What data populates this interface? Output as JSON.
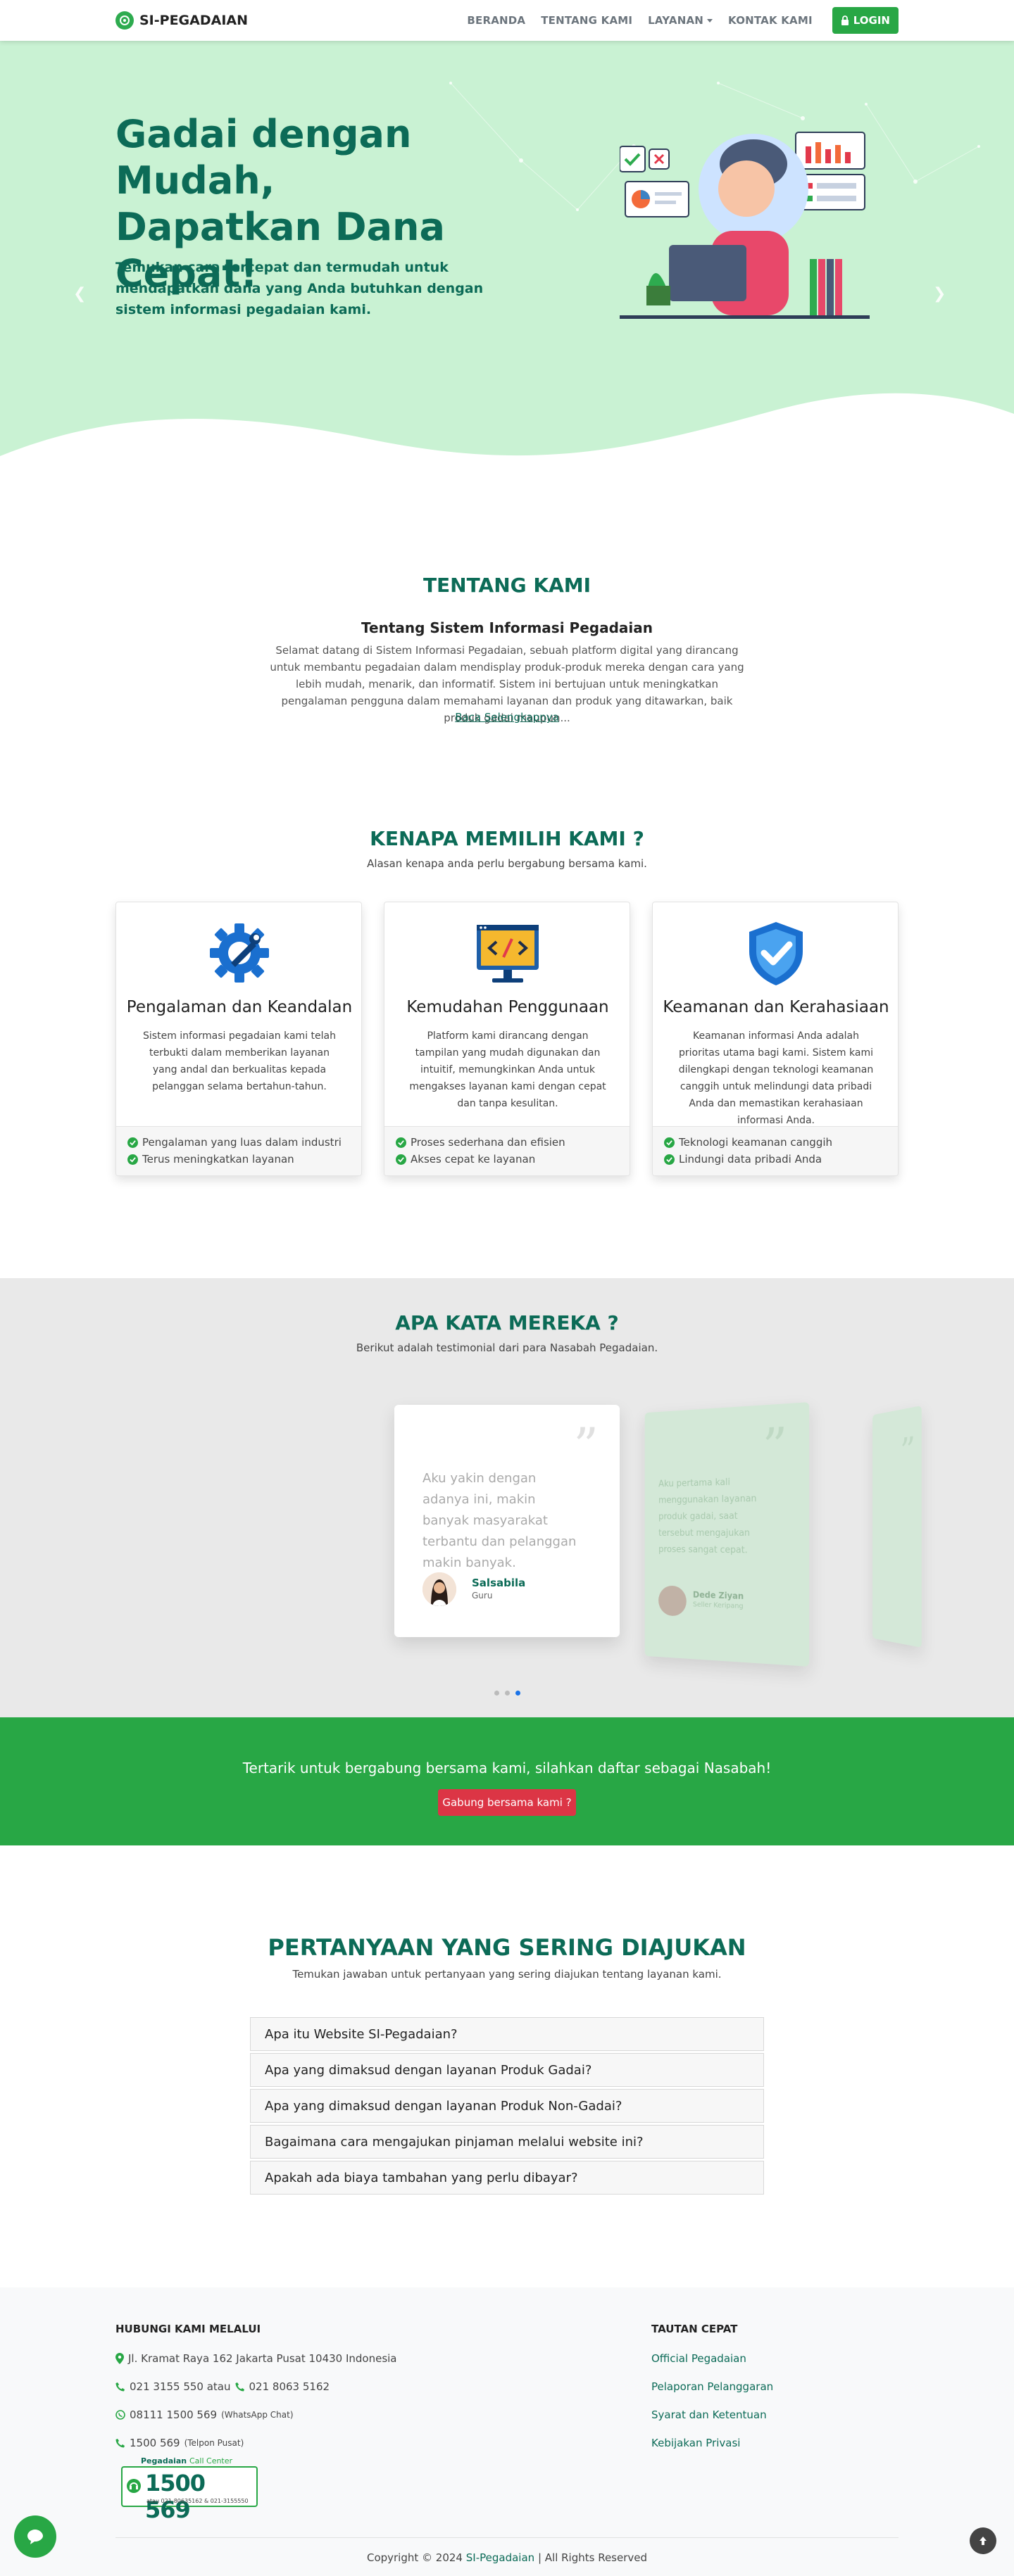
{
  "navbar": {
    "brand": "SI-PEGADAIAN",
    "links": [
      "BERANDA",
      "TENTANG KAMI",
      "LAYANAN",
      "KONTAK KAMI"
    ],
    "login": "LOGIN"
  },
  "hero": {
    "title": "Gadai dengan Mudah, Dapatkan Dana Cepat!",
    "subtitle": "Temukan cara tercepat dan termudah untuk mendapatkan dana yang Anda butuhkan dengan sistem informasi pegadaian kami."
  },
  "tentang": {
    "title": "TENTANG KAMI",
    "subtitle": "Tentang Sistem Informasi Pegadaian",
    "body": "Selamat datang di Sistem Informasi Pegadaian, sebuah platform digital yang dirancang untuk membantu pegadaian dalam mendisplay produk-produk mereka dengan cara yang lebih mudah, menarik, dan informatif. Sistem ini bertujuan untuk meningkatkan pengalaman pengguna dalam memahami layanan dan produk yang ditawarkan, baik produk gadai maupun...",
    "read_more": "Baca Selengkapnya"
  },
  "why": {
    "title": "KENAPA MEMILIH KAMI ?",
    "subtitle": "Alasan kenapa anda perlu bergabung bersama kami.",
    "cards": [
      {
        "icon": "gear-wrench-icon",
        "title": "Pengalaman dan Keandalan",
        "desc": "Sistem informasi pegadaian kami telah terbukti dalam memberikan layanan yang andal dan berkualitas kepada pelanggan selama bertahun-tahun.",
        "points": [
          "Pengalaman yang luas dalam industri",
          "Terus meningkatkan layanan"
        ]
      },
      {
        "icon": "monitor-code-icon",
        "title": "Kemudahan Penggunaan",
        "desc": "Platform kami dirancang dengan tampilan yang mudah digunakan dan intuitif, memungkinkan Anda untuk mengakses layanan kami dengan cepat dan tanpa kesulitan.",
        "points": [
          "Proses sederhana dan efisien",
          "Akses cepat ke layanan"
        ]
      },
      {
        "icon": "shield-check-icon",
        "title": "Keamanan dan Kerahasiaan",
        "desc": "Keamanan informasi Anda adalah prioritas utama bagi kami. Sistem kami dilengkapi dengan teknologi keamanan canggih untuk melindungi data pribadi Anda dan memastikan kerahasiaan informasi Anda.",
        "points": [
          "Teknologi keamanan canggih",
          "Lindungi data pribadi Anda"
        ]
      }
    ]
  },
  "testimonials": {
    "title": "APA KATA MEREKA ?",
    "subtitle": "Berikut adalah testimonial dari para Nasabah Pegadaian.",
    "main": {
      "quote": "Aku yakin dengan adanya ini, makin banyak masyarakat terbantu dan pelanggan makin banyak.",
      "name": "Salsabila",
      "role": "Guru"
    },
    "side": {
      "quote": "Aku pertama kali menggunakan layanan produk gadai, saat tersebut mengajukan proses sangat cepat.",
      "name": "Dede Ziyan",
      "role": "Seller Keripang"
    },
    "active_slide": 3,
    "slides": 3
  },
  "cta": {
    "text": "Tertarik untuk bergabung bersama kami, silahkan daftar sebagai Nasabah!",
    "button": "Gabung bersama kami ?"
  },
  "faq": {
    "title": "PERTANYAAN YANG SERING DIAJUKAN",
    "subtitle": "Temukan jawaban untuk pertanyaan yang sering diajukan tentang layanan kami.",
    "items": [
      "Apa itu Website SI-Pegadaian?",
      "Apa yang dimaksud dengan layanan Produk Gadai?",
      "Apa yang dimaksud dengan layanan Produk Non-Gadai?",
      "Bagaimana cara mengajukan pinjaman melalui website ini?",
      "Apakah ada biaya tambahan yang perlu dibayar?"
    ]
  },
  "footer": {
    "contact_head": "HUBUNGI KAMI MELALUI",
    "address": "Jl. Kramat Raya 162 Jakarta Pusat 10430 Indonesia",
    "phone1": "021 3155 550 atau",
    "phone2": "021 8063 5162",
    "whatsapp": "08111 1500 569",
    "whatsapp_note": "(WhatsApp Chat)",
    "hotline": "1500 569",
    "hotline_note": "(Telpon Pusat)",
    "callcenter_label": "Pegadaian",
    "callcenter_label2": "Call Center",
    "callcenter_number": "1500 569",
    "callcenter_small": "atau 021-80635162 & 021-3155550",
    "links_head": "TAUTAN CEPAT",
    "links": [
      "Official Pegadaian",
      "Pelaporan Pelanggaran",
      "Syarat dan Ketentuan",
      "Kebijakan Privasi"
    ],
    "copy_prefix": "Copyright © 2024",
    "copy_brand": "SI-Pegadaian",
    "copy_suffix": "| All Rights Reserved"
  },
  "colors": {
    "primary_green": "#28a745",
    "dark_teal": "#0c6b57",
    "hero_bg": "#c9f2d3",
    "danger": "#dc3545"
  }
}
